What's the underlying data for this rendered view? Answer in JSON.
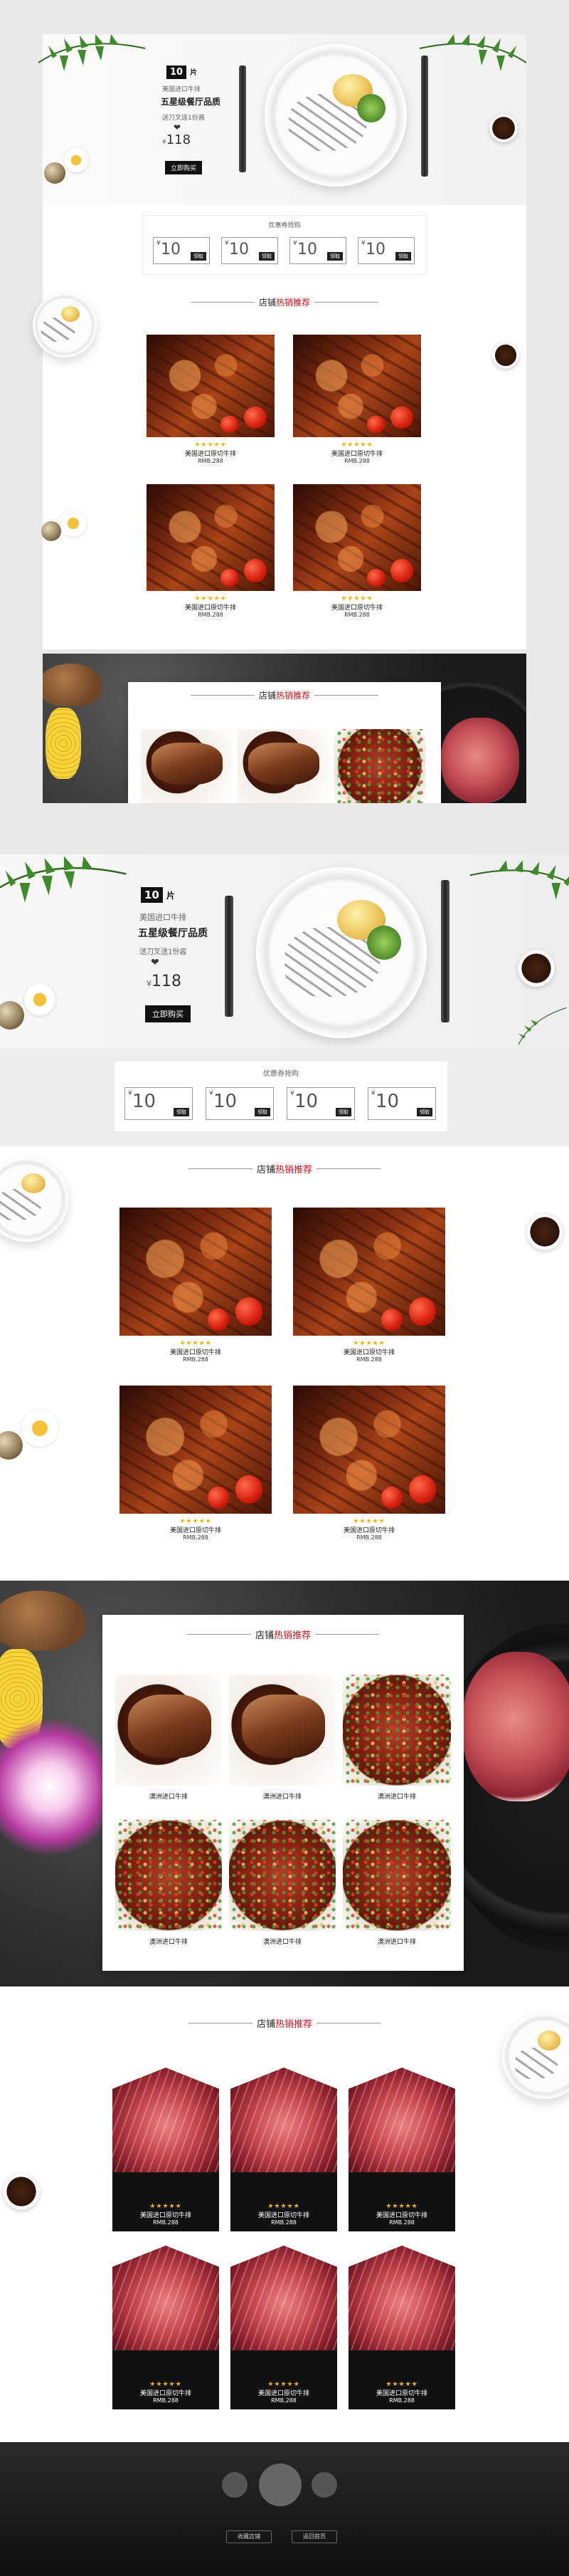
{
  "banner": {
    "badge_num": "10",
    "badge_unit": "片",
    "line1": "美国进口牛排",
    "title": "五星级餐厅品质",
    "line3": "送刀叉送1份酱",
    "price_symbol": "¥",
    "price": "118",
    "buy": "立即购买"
  },
  "coupons": {
    "header": "优惠券抢购",
    "items": [
      {
        "symbol": "¥",
        "value": "10",
        "btn": "领取"
      },
      {
        "symbol": "¥",
        "value": "10",
        "btn": "领取"
      },
      {
        "symbol": "¥",
        "value": "10",
        "btn": "领取"
      },
      {
        "symbol": "¥",
        "value": "10",
        "btn": "领取"
      }
    ]
  },
  "section": {
    "title_pre": "店铺",
    "title_hot": "热销推荐"
  },
  "grid": {
    "stars": "★★★★★",
    "name": "美国进口原切牛排",
    "price": "RMB.288"
  },
  "card": {
    "name": "澳洲进口牛排"
  },
  "hex": {
    "stars": "★★★★★",
    "name": "美国进口原切牛排",
    "price": "RMB.288"
  },
  "footer": {
    "btn1": "收藏店铺",
    "btn2": "返回首页"
  }
}
